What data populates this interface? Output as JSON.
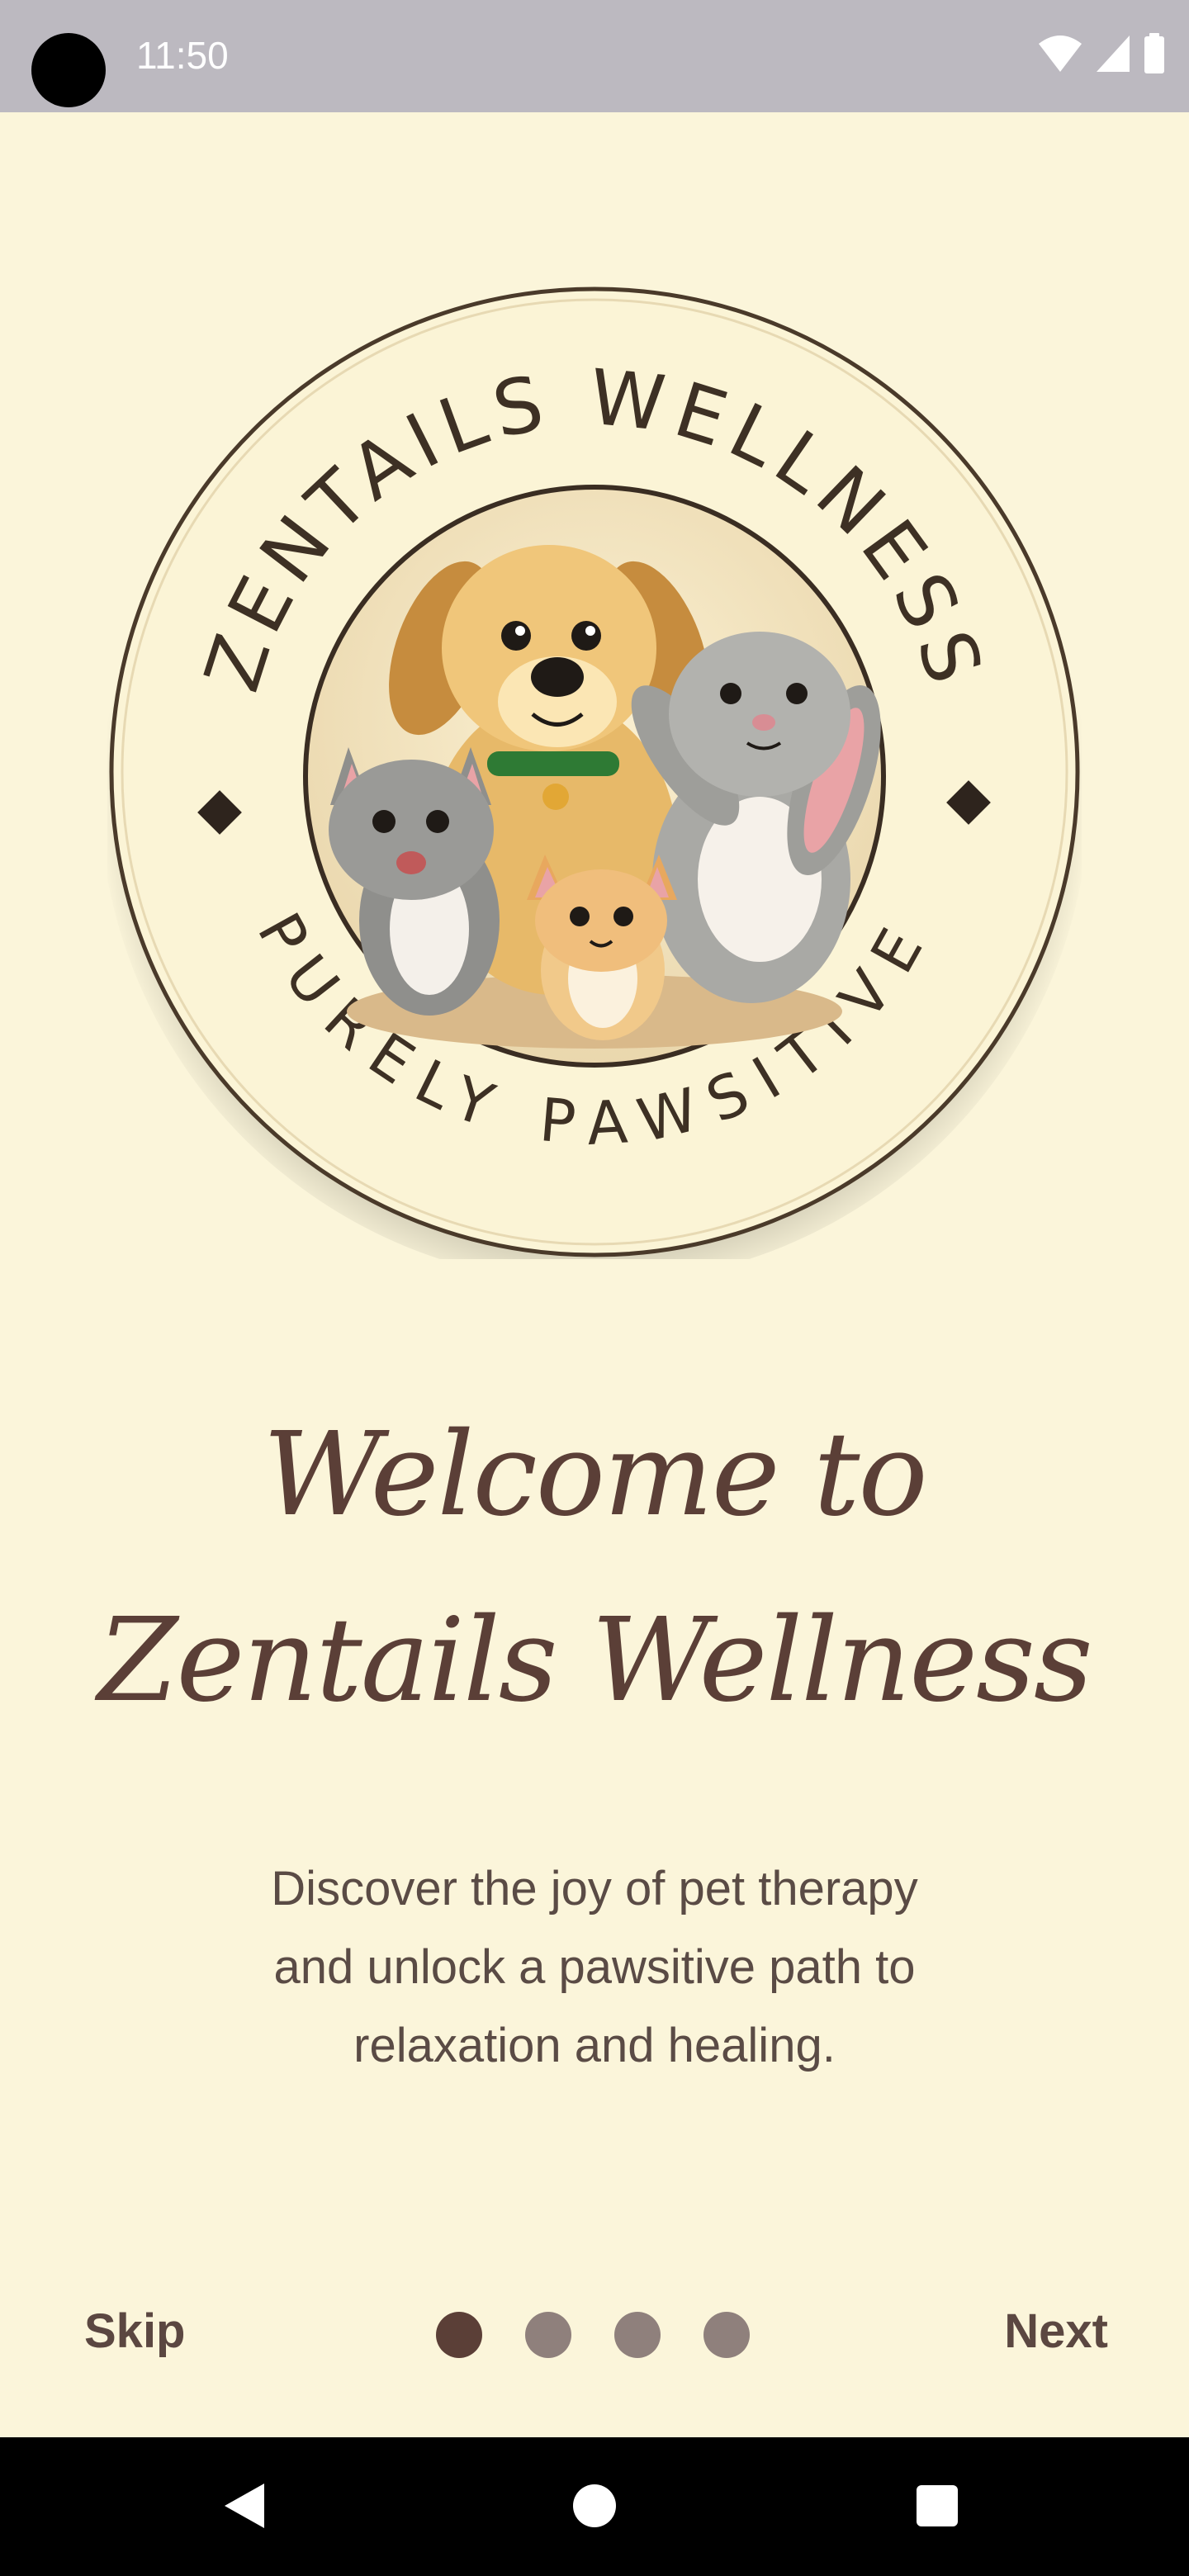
{
  "status_bar": {
    "time": "11:50",
    "icons": [
      "wifi-icon",
      "signal-icon",
      "battery-icon"
    ]
  },
  "logo": {
    "top_text": "ZENTAILS WELLNESS",
    "bottom_text": "PURELY PAWSITIVE"
  },
  "onboarding": {
    "title_line_1": "Welcome to",
    "title_line_2": "Zentails Wellness",
    "description_lines": [
      "Discover the joy of pet therapy",
      "and unlock a pawsitive path to",
      "relaxation and healing."
    ],
    "skip_label": "Skip",
    "next_label": "Next",
    "page_count": 4,
    "current_page": 1
  },
  "colors": {
    "background": "#fbf5da",
    "accent": "#5b3f37",
    "dot_inactive": "#8f807c",
    "status_bar": "#bcb9c0"
  },
  "nav_bar": {
    "icons": [
      "back-icon",
      "home-icon",
      "recents-icon"
    ]
  }
}
